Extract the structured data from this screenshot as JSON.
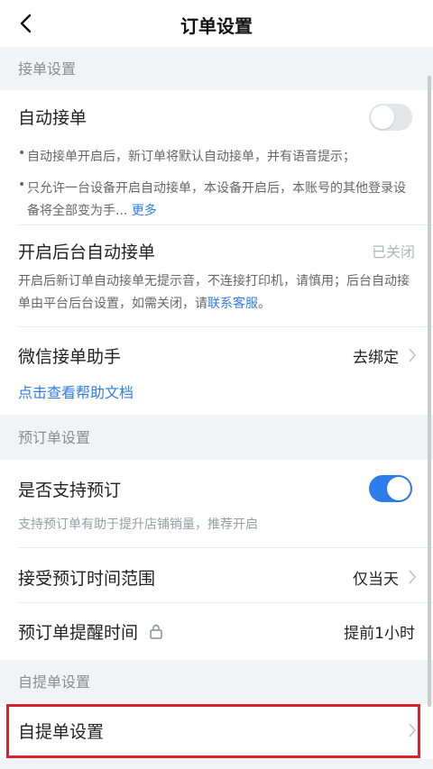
{
  "header": {
    "title": "订单设置"
  },
  "sections": {
    "accept": "接单设置",
    "preorder": "预订单设置",
    "pickup": "自提单设置"
  },
  "auto_accept": {
    "label": "自动接单",
    "toggle": "off",
    "note1": "自动接单开启后，新订单将默认自动接单，并有语音提示；",
    "note2": "只允许一台设备开启自动接单，本设备开启后，本账号的其他登录设备将全部变为手...",
    "more": "更多"
  },
  "background_accept": {
    "label": "开启后台自动接单",
    "status": "已关闭",
    "note": "开启后新订单自动接单无提示音，不连接打印机，请慎用；后台自动接单由平台后台设置，如需关闭，请",
    "link": "联系客服",
    "note_end": "。"
  },
  "wechat": {
    "label": "微信接单助手",
    "action": "去绑定",
    "help": "点击查看帮助文档"
  },
  "preorder_support": {
    "label": "是否支持预订",
    "toggle": "on",
    "hint": "支持预订单有助于提升店铺销量，推荐开启"
  },
  "preorder_range": {
    "label": "接受预订时间范围",
    "value": "仅当天"
  },
  "preorder_reminder": {
    "label": "预订单提醒时间",
    "value": "提前1小时"
  },
  "pickup_settings": {
    "label": "自提单设置"
  },
  "colors": {
    "accent": "#2f7ded",
    "highlight": "#d9222a"
  },
  "icons": [
    "back-arrow-icon",
    "chevron-right-icon",
    "lock-icon"
  ]
}
